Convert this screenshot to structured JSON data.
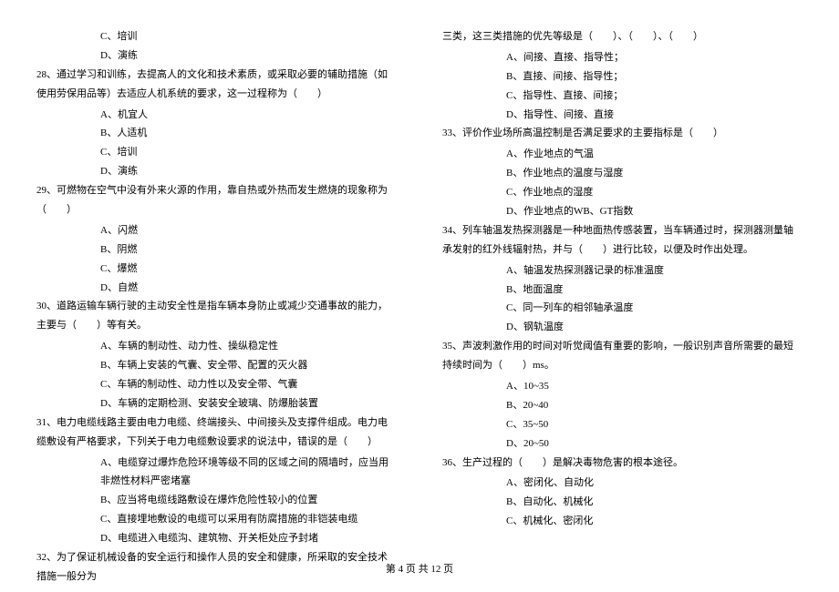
{
  "left": {
    "q27_options": {
      "c": "C、培训",
      "d": "D、演练"
    },
    "q28": {
      "text": "28、通过学习和训练，去提高人的文化和技术素质，或采取必要的辅助措施（如使用劳保用品等）去适应人机系统的要求，这一过程称为（　　）",
      "a": "A、机宜人",
      "b": "B、人适机",
      "c": "C、培训",
      "d": "D、演练"
    },
    "q29": {
      "text": "29、可燃物在空气中没有外来火源的作用，靠自热或外热而发生燃烧的现象称为（　　）",
      "a": "A、闪燃",
      "b": "B、阴燃",
      "c": "C、爆燃",
      "d": "D、自燃"
    },
    "q30": {
      "text": "30、道路运输车辆行驶的主动安全性是指车辆本身防止或减少交通事故的能力，主要与（　　）等有关。",
      "a": "A、车辆的制动性、动力性、操纵稳定性",
      "b": "B、车辆上安装的气囊、安全带、配置的灭火器",
      "c": "C、车辆的制动性、动力性以及安全带、气囊",
      "d": "D、车辆的定期检测、安装安全玻璃、防爆胎装置"
    },
    "q31": {
      "text": "31、电力电缆线路主要由电力电缆、终端接头、中间接头及支撑件组成。电力电缆敷设有严格要求，下列关于电力电缆敷设要求的说法中，错误的是（　　）",
      "a": "A、电缆穿过爆炸危险环境等级不同的区域之间的隔墙时，应当用非燃性材料严密堵塞",
      "b": "B、应当将电缆线路敷设在爆炸危险性较小的位置",
      "c": "C、直接埋地敷设的电缆可以采用有防腐措施的非铠装电缆",
      "d": "D、电缆进入电缆沟、建筑物、开关柜处应予封堵"
    },
    "q32": {
      "text": "32、为了保证机械设备的安全运行和操作人员的安全和健康，所采取的安全技术措施一般分为"
    }
  },
  "right": {
    "q32_cont": {
      "text": "三类，这三类措施的优先等级是（　　）、（　　）、（　　）",
      "a": "A、间接、直接、指导性；",
      "b": "B、直接、间接、指导性；",
      "c": "C、指导性、直接、间接；",
      "d": "D、指导性、间接、直接"
    },
    "q33": {
      "text": "33、评价作业场所高温控制是否满足要求的主要指标是（　　）",
      "a": "A、作业地点的气温",
      "b": "B、作业地点的温度与湿度",
      "c": "C、作业地点的湿度",
      "d": "D、作业地点的WB、GT指数"
    },
    "q34": {
      "text": "34、列车轴温发热探测器是一种地面热传感装置，当车辆通过时，探测器测量轴承发射的红外线辐射热，并与（　　）进行比较，以便及时作出处理。",
      "a": "A、轴温发热探测器记录的标准温度",
      "b": "B、地面温度",
      "c": "C、同一列车的相邻轴承温度",
      "d": "D、钢轨温度"
    },
    "q35": {
      "text": "35、声波刺激作用的时间对听觉阈值有重要的影响，一般识别声音所需要的最短持续时间为（　　）ms。",
      "a": "A、10~35",
      "b": "B、20~40",
      "c": "C、35~50",
      "d": "D、20~50"
    },
    "q36": {
      "text": "36、生产过程的（　　）是解决毒物危害的根本途径。",
      "a": "A、密闭化、自动化",
      "b": "B、自动化、机械化",
      "c": "C、机械化、密闭化"
    }
  },
  "footer": "第 4 页 共 12 页"
}
